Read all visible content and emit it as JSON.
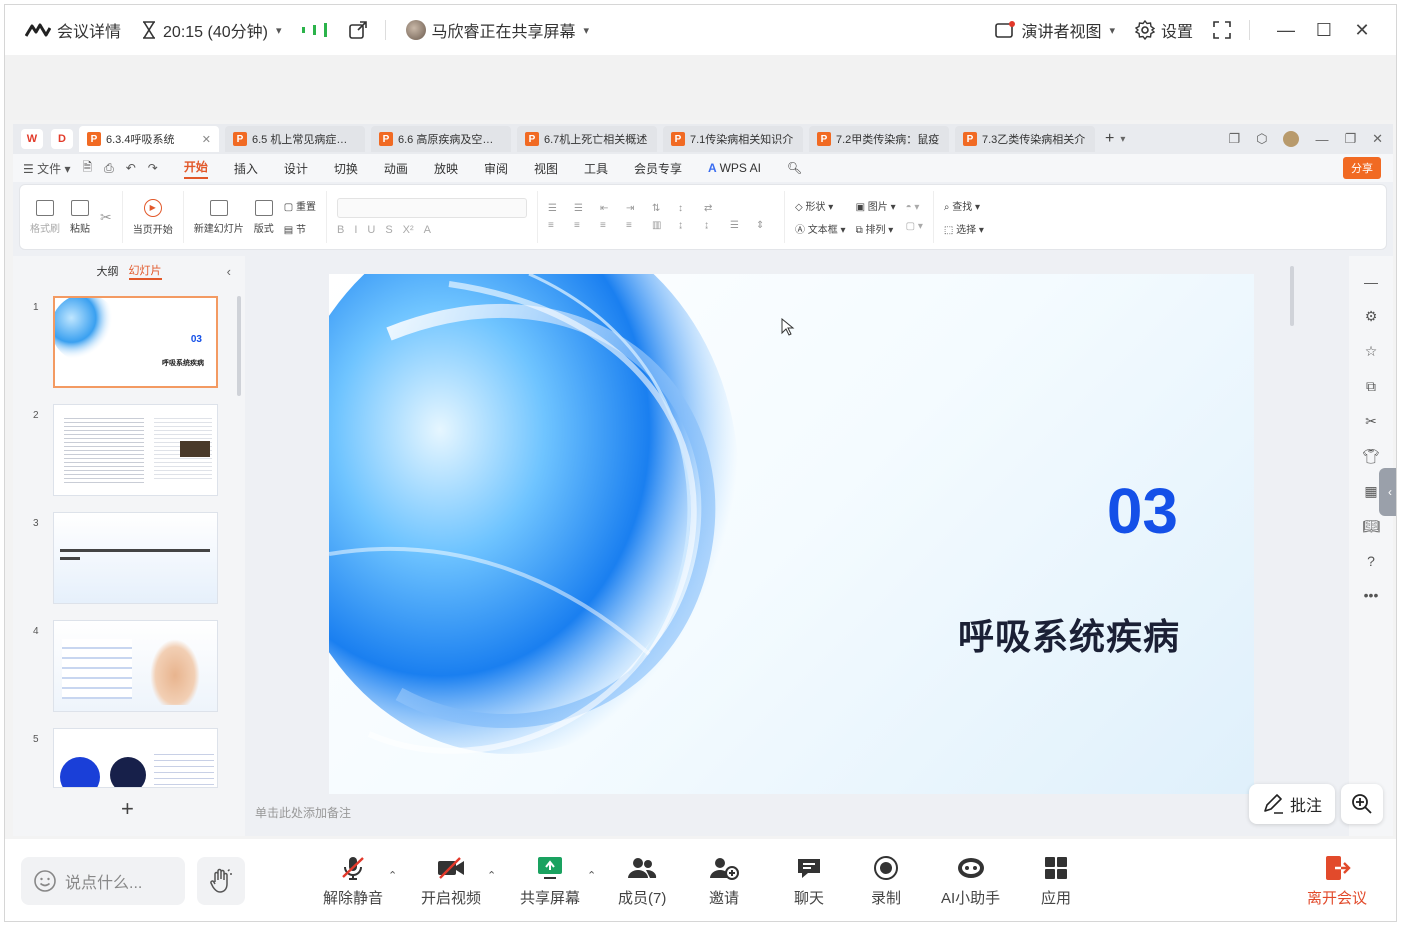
{
  "topbar": {
    "meeting_details": "会议详情",
    "time": "20:15 (40分钟)",
    "sharing_status": "马欣睿正在共享屏幕",
    "presenter_view": "演讲者视图",
    "settings": "设置"
  },
  "wps": {
    "tabs": [
      {
        "label": "6.3.4呼吸系统"
      },
      {
        "label": "6.5 机上常见病症及处"
      },
      {
        "label": "6.6 高原疾病及空勤人"
      },
      {
        "label": "6.7机上死亡相关概述"
      },
      {
        "label": "7.1传染病相关知识介"
      },
      {
        "label": "7.2甲类传染病：鼠疫"
      },
      {
        "label": "7.3乙类传染病相关介"
      }
    ],
    "menu": {
      "file": "文件",
      "items": [
        "开始",
        "插入",
        "设计",
        "切换",
        "动画",
        "放映",
        "审阅",
        "视图",
        "工具",
        "会员专享"
      ],
      "wps_ai": "WPS AI",
      "share": "分享"
    },
    "ribbon": {
      "format_painter": "格式刷",
      "paste": "粘贴",
      "from_current": "当页开始",
      "new_slide": "新建幻灯片",
      "layout": "版式",
      "reset": "重置",
      "section": "节",
      "shape": "形状",
      "picture": "图片",
      "textbox": "文本框",
      "arrange": "排列",
      "find": "查找",
      "select": "选择"
    },
    "panel": {
      "outline": "大纲",
      "slides": "幻灯片",
      "slide_numbers": [
        "1",
        "2",
        "3",
        "4",
        "5"
      ],
      "thumb1_num": "03",
      "thumb1_title": "呼吸系统疾病"
    },
    "slide": {
      "number": "03",
      "title": "呼吸系统疾病"
    },
    "notes_placeholder": "单击此处添加备注"
  },
  "annotate": "批注",
  "bottombar": {
    "say_placeholder": "说点什么...",
    "unmute": "解除静音",
    "start_video": "开启视频",
    "share_screen": "共享屏幕",
    "members": "成员(7)",
    "invite": "邀请",
    "chat": "聊天",
    "record": "录制",
    "ai_assistant": "AI小助手",
    "apps": "应用",
    "leave": "离开会议"
  }
}
